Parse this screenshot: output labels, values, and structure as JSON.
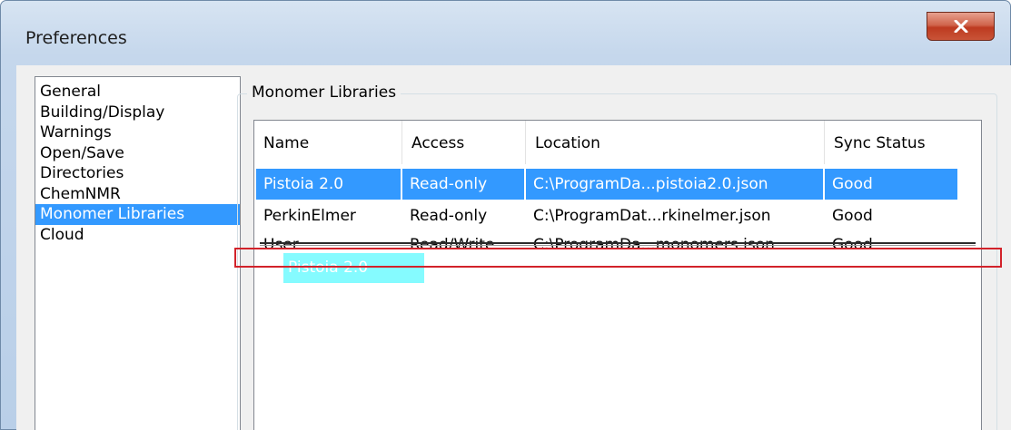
{
  "window": {
    "title": "Preferences",
    "close_icon": "close-x-icon"
  },
  "categories": [
    {
      "label": "General",
      "selected": false
    },
    {
      "label": "Building/Display",
      "selected": false
    },
    {
      "label": "Warnings",
      "selected": false
    },
    {
      "label": "Open/Save",
      "selected": false
    },
    {
      "label": "Directories",
      "selected": false
    },
    {
      "label": "ChemNMR",
      "selected": false
    },
    {
      "label": "Monomer Libraries",
      "selected": true
    },
    {
      "label": "Cloud",
      "selected": false
    }
  ],
  "panel": {
    "group_label": "Monomer Libraries",
    "columns": [
      "Name",
      "Access",
      "Location",
      "Sync Status"
    ],
    "rows": [
      {
        "name": "Pistoia 2.0",
        "access": "Read-only",
        "location": "C:\\ProgramDa...pistoia2.0.json",
        "sync": "Good",
        "selected": true
      },
      {
        "name": "PerkinElmer",
        "access": "Read-only",
        "location": "C:\\ProgramDat...rkinelmer.json",
        "sync": "Good",
        "selected": false
      },
      {
        "name": "User",
        "access": "Read/Write",
        "location": "C:\\ProgramDa...monomers.json",
        "sync": "Good",
        "selected": false
      }
    ],
    "drag_ghost_label": "Pistoia 2.0"
  },
  "colors": {
    "selection": "#3399ff",
    "highlight_box": "#d2222a",
    "drag_ghost": "#7ffbff"
  }
}
